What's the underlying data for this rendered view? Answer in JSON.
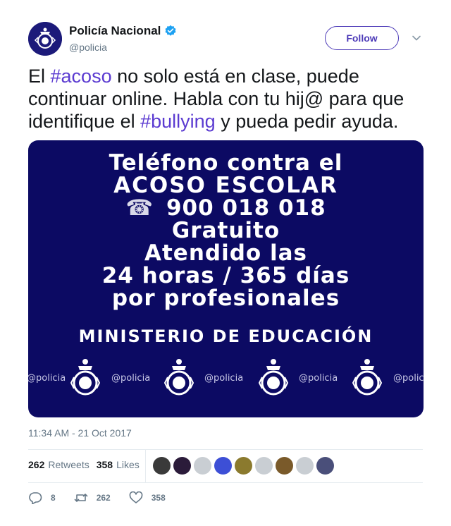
{
  "account": {
    "name": "Policía Nacional",
    "handle": "@policia",
    "follow_label": "Follow"
  },
  "tweet": {
    "text_parts": [
      "El ",
      "#acoso",
      " no solo está en clase, puede continuar online. Habla con tu hij@ para que identifique el ",
      "#bullying",
      " y pueda pedir ayuda."
    ],
    "timestamp": "11:34 AM - 21 Oct 2017"
  },
  "media": {
    "lines": [
      "Teléfono contra el",
      "ACOSO ESCOLAR",
      "900 018 018",
      "Gratuito",
      "Atendido las",
      "24 horas / 365 días",
      "por profesionales",
      "MINISTERIO DE EDUCACIÓN"
    ],
    "watermark": "@policia"
  },
  "stats": {
    "retweets_count": "262",
    "retweets_label": "Retweets",
    "likes_count": "358",
    "likes_label": "Likes"
  },
  "likers": [
    "#3a3a3a",
    "#2b1b3a",
    "#c9ced3",
    "#3d4fd6",
    "#8b7a2e",
    "#c9ced3",
    "#7a5a2a",
    "#c9ced3",
    "#4a4f7a"
  ],
  "actions": {
    "reply_count": "8",
    "retweet_count": "262",
    "like_count": "358"
  },
  "colors": {
    "accent": "#4d3bb8",
    "hashtag": "#5b3bd1",
    "media_bg": "#0c0a63",
    "verified": "#1da1f2"
  }
}
